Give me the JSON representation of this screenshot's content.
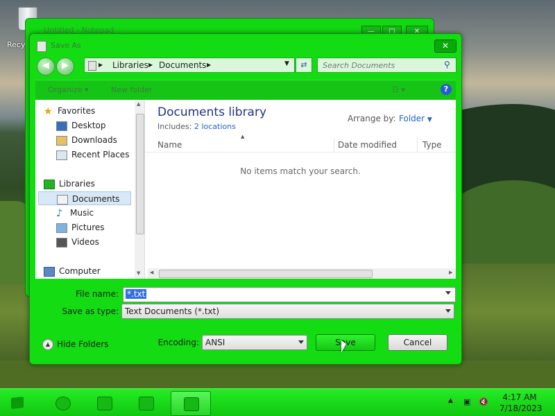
{
  "desktop": {
    "recycle_label": "Recy"
  },
  "notepad": {
    "title": "Untitled - Notepad"
  },
  "dialog": {
    "title": "Save As",
    "close_label": "✕",
    "address": {
      "segments": [
        "Libraries",
        "Documents"
      ]
    },
    "search_placeholder": "Search Documents",
    "toolbar": {
      "organize": "Organize ▾",
      "new_folder": "New folder",
      "help": "?"
    },
    "nav": {
      "favorites": "Favorites",
      "fav_items": [
        "Desktop",
        "Downloads",
        "Recent Places"
      ],
      "libraries": "Libraries",
      "lib_items": [
        "Documents",
        "Music",
        "Pictures",
        "Videos"
      ],
      "computer": "Computer"
    },
    "content": {
      "title": "Documents library",
      "includes_label": "Includes:",
      "includes_link": "2 locations",
      "arrange_label": "Arrange by:",
      "arrange_value": "Folder",
      "columns": [
        "Name",
        "Date modified",
        "Type"
      ],
      "empty_message": "No items match your search."
    },
    "form": {
      "file_name_label": "File name:",
      "file_name_value": "*.txt",
      "save_type_label": "Save as type:",
      "save_type_value": "Text Documents (*.txt)",
      "encoding_label": "Encoding:",
      "encoding_value": "ANSI",
      "hide_folders": "Hide Folders",
      "save_button": "Save",
      "cancel_button": "Cancel"
    }
  },
  "taskbar": {
    "time": "4:17 AM",
    "date": "7/18/2023"
  }
}
